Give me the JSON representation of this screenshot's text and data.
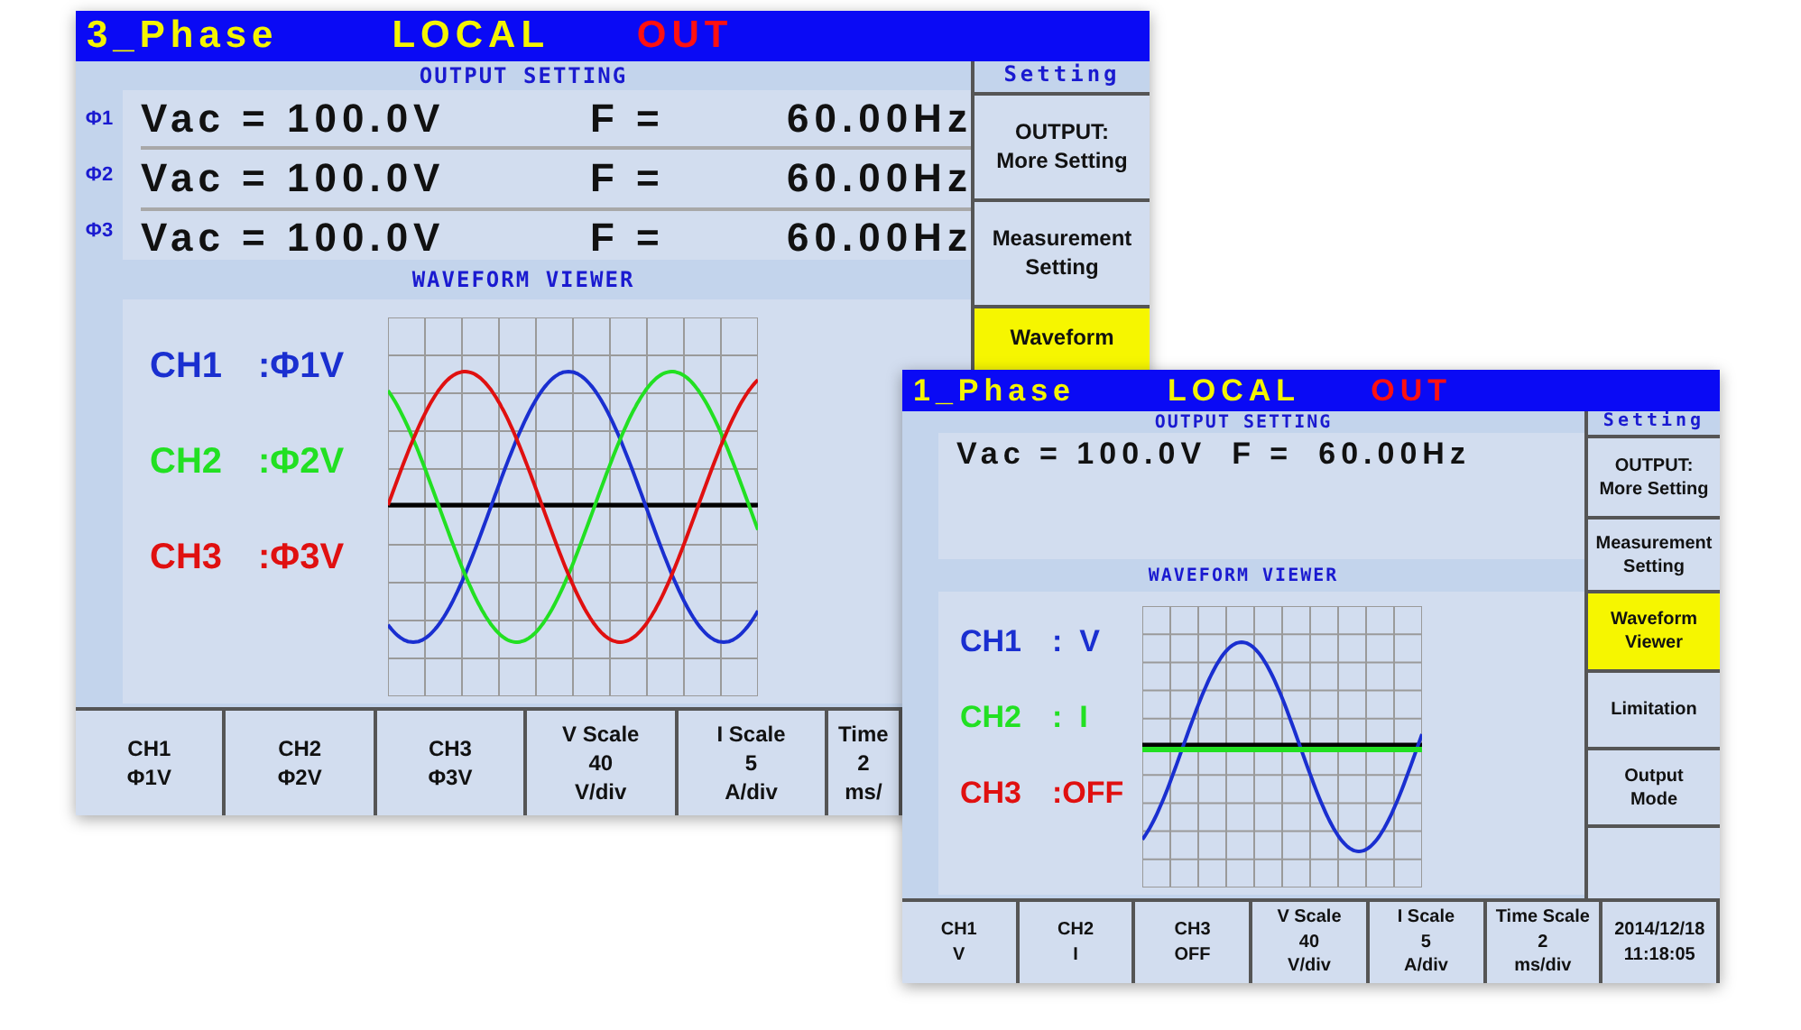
{
  "windows": [
    {
      "kind": "three_phase",
      "title": {
        "mode": "3_Phase",
        "control": "LOCAL",
        "output": "OUT"
      },
      "output_setting": {
        "heading": "OUTPUT SETTING",
        "rows": [
          {
            "phase": "Φ1",
            "voltage": "Vac = 100.0V",
            "frequency_label": "F =",
            "frequency": "60.00Hz"
          },
          {
            "phase": "Φ2",
            "voltage": "Vac = 100.0V",
            "frequency_label": "F =",
            "frequency": "60.00Hz"
          },
          {
            "phase": "Φ3",
            "voltage": "Vac = 100.0V",
            "frequency_label": "F =",
            "frequency": "60.00Hz"
          }
        ]
      },
      "waveform_viewer": {
        "heading": "WAVEFORM VIEWER",
        "channels": [
          {
            "label": "CH1",
            "source": ":Φ1V",
            "color": "#1a2fd0",
            "kind": "sine"
          },
          {
            "label": "CH2",
            "source": ":Φ2V",
            "color": "#22e022",
            "kind": "sine"
          },
          {
            "label": "CH3",
            "source": ":Φ3V",
            "color": "#e01010",
            "kind": "sine"
          }
        ]
      },
      "sidebar": {
        "heading": "Setting",
        "items": [
          {
            "label": "OUTPUT:\nMore Setting",
            "selected": false
          },
          {
            "label": "Measurement\nSetting",
            "selected": false
          },
          {
            "label": "Waveform",
            "selected": true
          }
        ]
      },
      "softkeys": [
        {
          "lines": [
            "CH1",
            "Φ1V"
          ]
        },
        {
          "lines": [
            "CH2",
            "Φ2V"
          ]
        },
        {
          "lines": [
            "CH3",
            "Φ3V"
          ]
        },
        {
          "lines": [
            "V Scale",
            "40",
            "V/div"
          ]
        },
        {
          "lines": [
            "I Scale",
            "5",
            "A/div"
          ]
        },
        {
          "lines": [
            "Time",
            "2",
            "ms/"
          ]
        }
      ]
    },
    {
      "kind": "single_phase",
      "title": {
        "mode": "1_Phase",
        "control": "LOCAL",
        "output": "OUT"
      },
      "output_setting": {
        "heading": "OUTPUT SETTING",
        "rows": [
          {
            "voltage": "Vac = 100.0V",
            "frequency_label": "F =",
            "frequency": "60.00Hz"
          }
        ]
      },
      "waveform_viewer": {
        "heading": "WAVEFORM VIEWER",
        "channels": [
          {
            "label": "CH1",
            "source": ":  V",
            "color": "#1a2fd0",
            "kind": "sine"
          },
          {
            "label": "CH2",
            "source": ":  I",
            "color": "#22e022",
            "kind": "flat"
          },
          {
            "label": "CH3",
            "source": ":OFF",
            "color": "#e01010",
            "kind": "off"
          }
        ]
      },
      "sidebar": {
        "heading": "Setting",
        "items": [
          {
            "label": "OUTPUT:\nMore Setting",
            "selected": false
          },
          {
            "label": "Measurement\nSetting",
            "selected": false
          },
          {
            "label": "Waveform\nViewer",
            "selected": true
          },
          {
            "label": "Limitation",
            "selected": false
          },
          {
            "label": "Output\nMode",
            "selected": false
          }
        ]
      },
      "softkeys": [
        {
          "lines": [
            "CH1",
            "V"
          ]
        },
        {
          "lines": [
            "CH2",
            "I"
          ]
        },
        {
          "lines": [
            "CH3",
            "OFF"
          ]
        },
        {
          "lines": [
            "V Scale",
            "40",
            "V/div"
          ]
        },
        {
          "lines": [
            "I Scale",
            "5",
            "A/div"
          ]
        },
        {
          "lines": [
            "Time Scale",
            "2",
            "ms/div"
          ]
        },
        {
          "lines": [
            "2014/12/18",
            "11:18:05"
          ]
        }
      ]
    }
  ]
}
